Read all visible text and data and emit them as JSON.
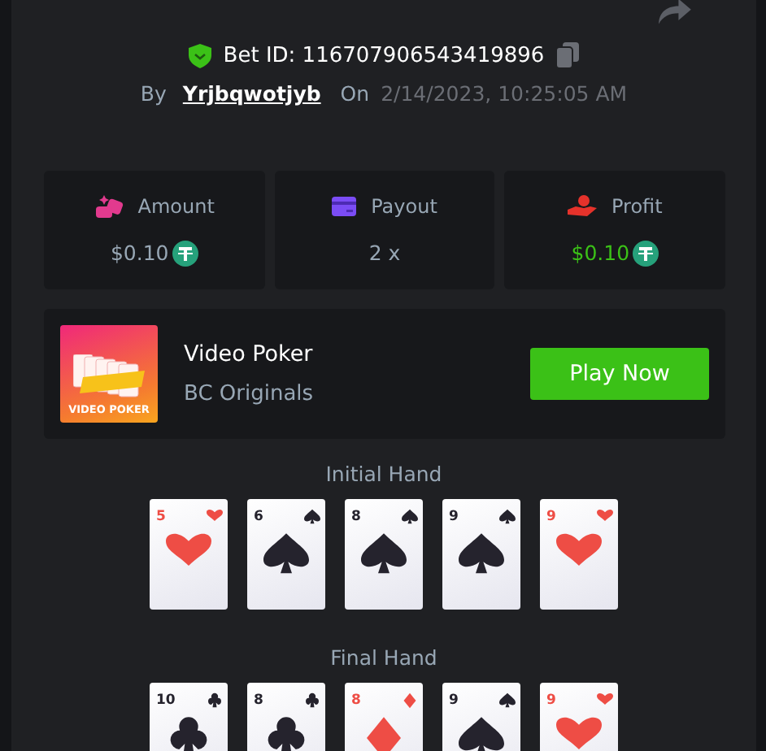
{
  "bet": {
    "verified": true,
    "id_label": "Bet ID: 116707906543419896",
    "by_label": "By",
    "user": "Yrjbqwotjyb",
    "on_label": "On",
    "date": "2/14/2023, 10:25:05 AM"
  },
  "stats": [
    {
      "kind": "amount",
      "label": "Amount",
      "value": "$0.10",
      "currency": true,
      "positive": false
    },
    {
      "kind": "payout",
      "label": "Payout",
      "value": "2 x",
      "currency": false,
      "positive": false
    },
    {
      "kind": "profit",
      "label": "Profit",
      "value": "$0.10",
      "currency": true,
      "positive": true
    }
  ],
  "game": {
    "title": "Video Poker",
    "provider": "BC Originals",
    "thumb_text": "VIDEO POKER",
    "button": "Play Now"
  },
  "hands": [
    {
      "title": "Initial Hand",
      "cards": [
        {
          "rank": "5",
          "kind": "hearts"
        },
        {
          "rank": "6",
          "kind": "spades"
        },
        {
          "rank": "8",
          "kind": "spades"
        },
        {
          "rank": "9",
          "kind": "spades"
        },
        {
          "rank": "9",
          "kind": "hearts"
        }
      ]
    },
    {
      "title": "Final Hand",
      "cards": [
        {
          "rank": "10",
          "kind": "clubs"
        },
        {
          "rank": "8",
          "kind": "clubs"
        },
        {
          "rank": "8",
          "kind": "diamonds"
        },
        {
          "rank": "9",
          "kind": "spades"
        },
        {
          "rank": "9",
          "kind": "hearts"
        }
      ]
    }
  ]
}
